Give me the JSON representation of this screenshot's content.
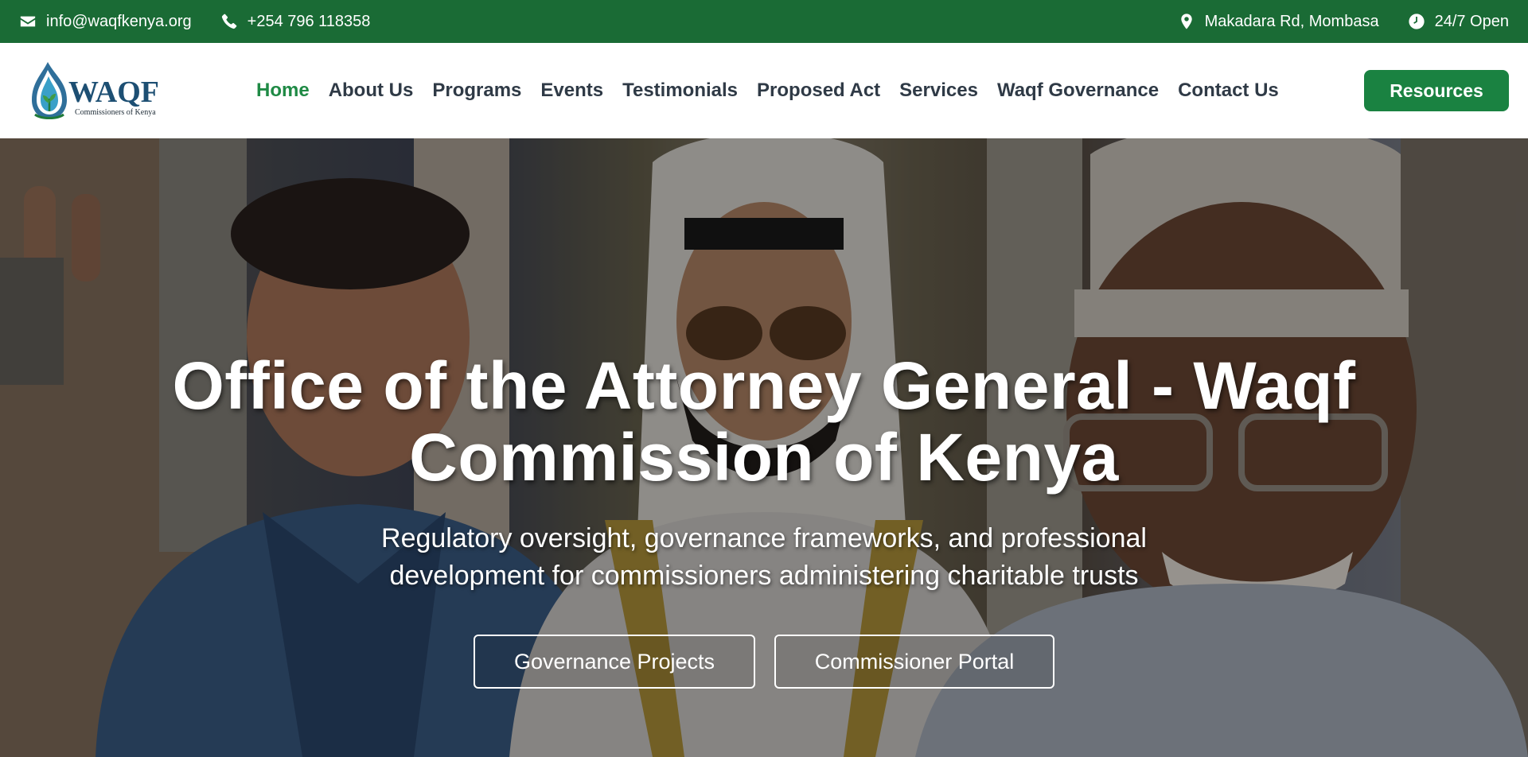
{
  "topbar": {
    "email": "info@waqfkenya.org",
    "phone": "+254 796 118358",
    "address": "Makadara Rd, Mombasa",
    "hours": "24/7 Open",
    "icons": {
      "email": "envelope-icon",
      "phone": "phone-icon",
      "address": "map-pin-icon",
      "hours": "clock-icon"
    },
    "background_color": "#1a6b35"
  },
  "logo": {
    "wordmark": "WAQF",
    "tagline": "Commissioners of Kenya"
  },
  "nav": {
    "items": [
      {
        "label": "Home",
        "active": true
      },
      {
        "label": "About Us"
      },
      {
        "label": "Programs"
      },
      {
        "label": "Events"
      },
      {
        "label": "Testimonials"
      },
      {
        "label": "Proposed Act"
      },
      {
        "label": "Services"
      },
      {
        "label": "Waqf Governance"
      },
      {
        "label": "Contact Us"
      }
    ],
    "active_color": "#1f8a45",
    "text_color": "#2f3a46"
  },
  "header": {
    "resources_label": "Resources",
    "button_color": "#1a8241"
  },
  "hero": {
    "title": "Office of the Attorney General - Waqf Commission of Kenya",
    "subtitle": "Regulatory oversight, governance frameworks, and professional development for commissioners administering charitable trusts",
    "buttons": {
      "governance_label": "Governance Projects",
      "portal_label": "Commissioner Portal"
    }
  }
}
